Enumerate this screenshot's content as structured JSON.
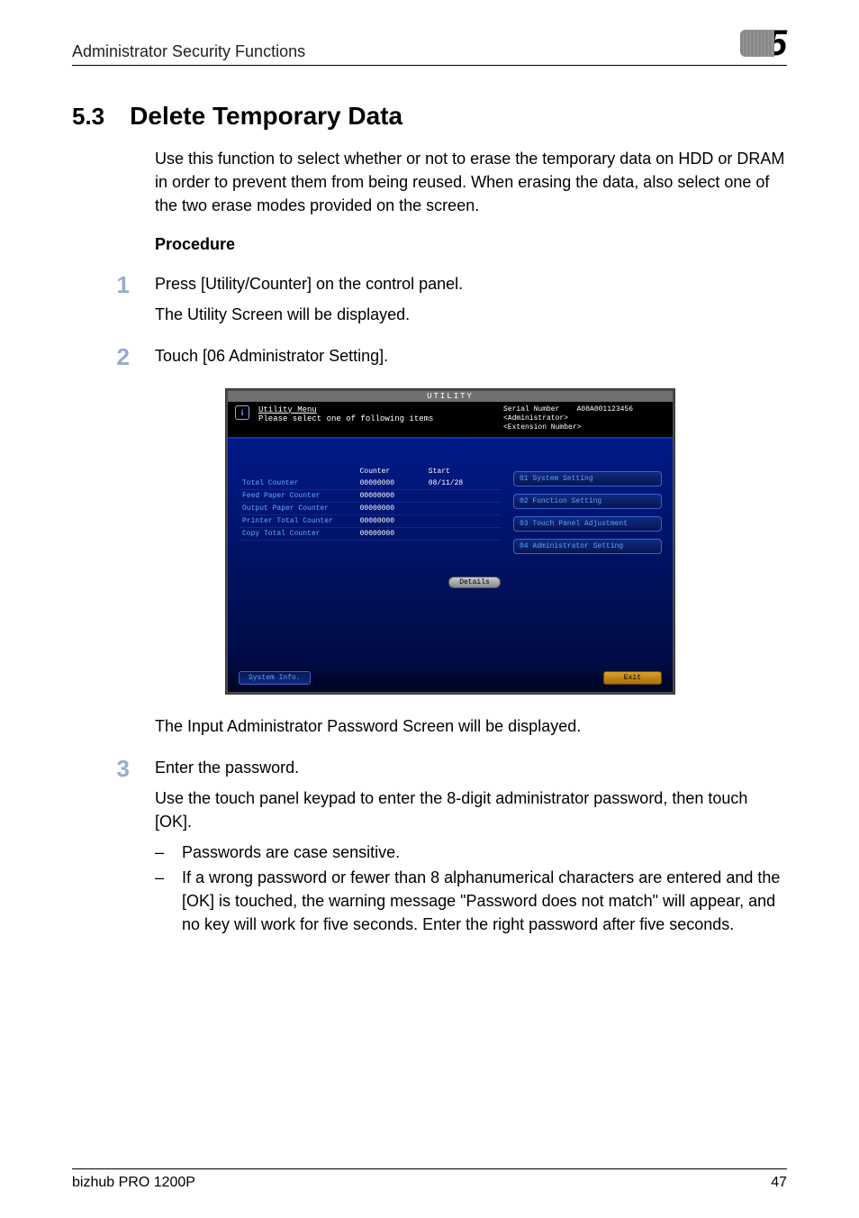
{
  "header": {
    "runningHead": "Administrator Security Functions",
    "chapterNumber": "5"
  },
  "section": {
    "number": "5.3",
    "title": "Delete Temporary Data",
    "intro": "Use this function to select whether or not to erase the temporary data on HDD or DRAM in order to prevent them from being reused. When erasing the data, also select one of the two erase modes provided on the screen.",
    "procedureLabel": "Procedure"
  },
  "steps": [
    {
      "num": "1",
      "lines": [
        "Press [Utility/Counter] on the control panel.",
        "The Utility Screen will be displayed."
      ]
    },
    {
      "num": "2",
      "lines": [
        "Touch [06 Administrator Setting]."
      ]
    }
  ],
  "step2_after": "The Input Administrator Password Screen will be displayed.",
  "step3": {
    "num": "3",
    "line1": "Enter the password.",
    "line2": "Use the touch panel keypad to enter the 8-digit administrator password, then touch [OK].",
    "bullets": [
      "Passwords are case sensitive.",
      "If a wrong password or fewer than 8 alphanumerical characters are entered and the [OK] is touched, the warning message \"Password does not match\" will appear, and no key will work for five seconds. Enter the right password after five seconds."
    ]
  },
  "screenshot": {
    "windowTitle": "UTILITY",
    "headerLeft": {
      "line1": "Utility Menu",
      "line2": "Please select one of following items"
    },
    "headerRight": {
      "serialLabel": "Serial Number",
      "serialValue": "A08A001123456",
      "admin": "<Administrator>",
      "ext": "<Extension Number>"
    },
    "counterHeader": {
      "c1": "",
      "c2": "Counter",
      "c3": "Start"
    },
    "counters": [
      {
        "label": "Total Counter",
        "value": "00000000",
        "start": "08/11/28"
      },
      {
        "label": "Feed Paper Counter",
        "value": "00000000",
        "start": ""
      },
      {
        "label": "Output Paper Counter",
        "value": "00000000",
        "start": ""
      },
      {
        "label": "Printer Total Counter",
        "value": "00000000",
        "start": ""
      },
      {
        "label": "Copy Total Counter",
        "value": "00000000",
        "start": ""
      }
    ],
    "detailsBtn": "Details",
    "menu": [
      "01 System Setting",
      "02 Function Setting",
      "03 Touch Panel Adjustment",
      "04 Administrator Setting"
    ],
    "systemInfoBtn": "System Info.",
    "exitBtn": "Exit"
  },
  "footer": {
    "product": "bizhub PRO 1200P",
    "page": "47"
  }
}
